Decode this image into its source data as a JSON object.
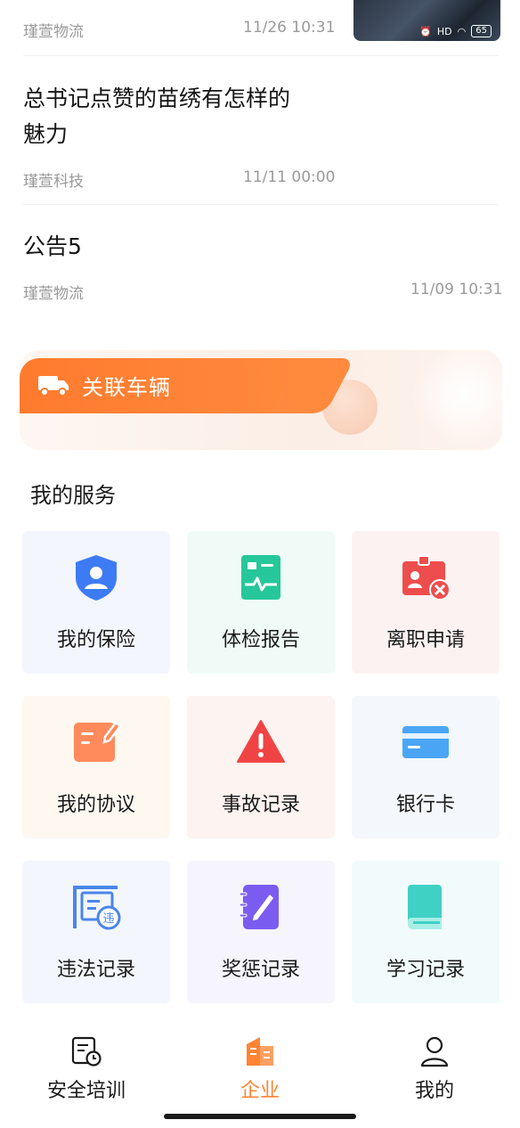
{
  "news": [
    {
      "title": "",
      "source": "瑾萱物流",
      "time": "11/26 10:31"
    },
    {
      "title_line1": "总书记点赞的苗绣有怎样的",
      "title_line2": "魅力",
      "source": "瑾萱科技",
      "time": "11/11 00:00"
    },
    {
      "title": "公告5",
      "source": "瑾萱物流",
      "time": "11/09 10:31"
    }
  ],
  "thumbnail_status": {
    "hd": "HD",
    "battery": "65"
  },
  "vehicle": {
    "label": "关联车辆",
    "icon": "truck-icon"
  },
  "services": {
    "title": "我的服务",
    "items": [
      {
        "label": "我的保险",
        "icon": "shield-user-icon",
        "color": "#3d7bf5"
      },
      {
        "label": "体检报告",
        "icon": "health-report-icon",
        "color": "#26c79a"
      },
      {
        "label": "离职申请",
        "icon": "badge-remove-icon",
        "color": "#ee4d4d"
      },
      {
        "label": "我的协议",
        "icon": "agreement-icon",
        "color": "#ff8a5c"
      },
      {
        "label": "事故记录",
        "icon": "warning-icon",
        "color": "#f04444"
      },
      {
        "label": "银行卡",
        "icon": "bank-card-icon",
        "color": "#4aa6f5"
      },
      {
        "label": "违法记录",
        "icon": "violation-icon",
        "color": "#4a86e8"
      },
      {
        "label": "奖惩记录",
        "icon": "notebook-pen-icon",
        "color": "#7b5cf0"
      },
      {
        "label": "学习记录",
        "icon": "book-icon",
        "color": "#3fd1c4"
      }
    ]
  },
  "tabbar": [
    {
      "label": "安全培训",
      "icon": "training-icon"
    },
    {
      "label": "企业",
      "icon": "enterprise-icon",
      "active": true
    },
    {
      "label": "我的",
      "icon": "profile-icon"
    }
  ],
  "colors": {
    "accent": "#ff8433",
    "text": "#1a1a1a",
    "muted": "#9a9a9a"
  }
}
